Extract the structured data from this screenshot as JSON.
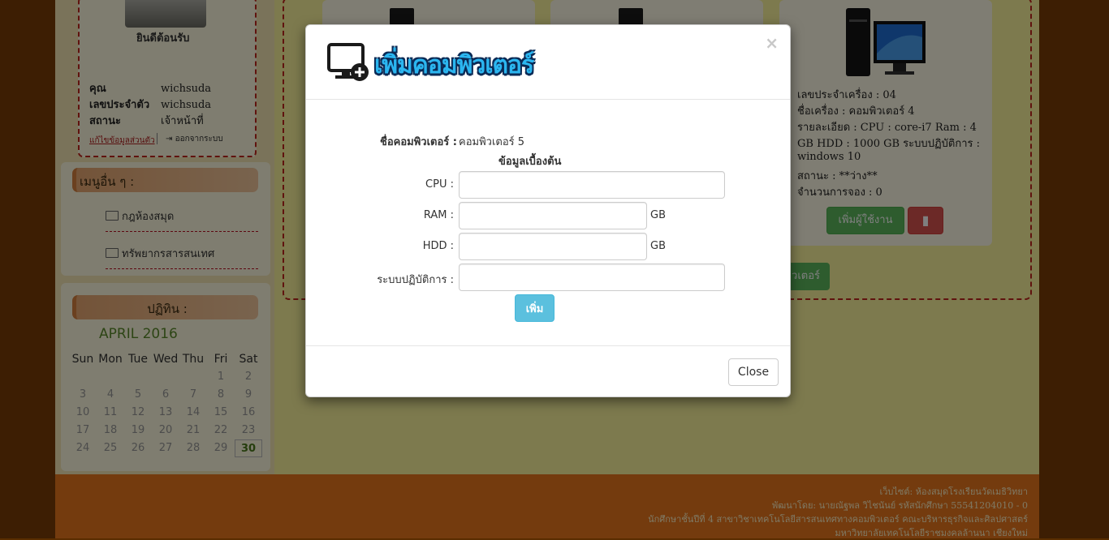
{
  "profile": {
    "welcome": "ยินดีต้อนรับ",
    "name_label": "คุณ",
    "name_value": "wichsuda",
    "id_label": "เลขประจำตัว",
    "id_value": "wichsuda",
    "status_label": "สถานะ",
    "status_value": "เจ้าหน้าที่",
    "edit_link": "แก้ไขข้อมูลส่วนตัว",
    "logout": "ออกจากระบบ"
  },
  "menu": {
    "title": "เมนูอื่น ๆ :",
    "items": [
      "กฎห้องสมุด",
      "ทรัพยากรสารสนเทศ"
    ]
  },
  "calendar": {
    "title": "ปฏิทิน :",
    "month": "APRIL 2016",
    "days": [
      "Sun",
      "Mon",
      "Tue",
      "Wed",
      "Thu",
      "Fri",
      "Sat"
    ],
    "weeks": [
      [
        "",
        "",
        "",
        "",
        "",
        "1",
        "2"
      ],
      [
        "3",
        "4",
        "5",
        "6",
        "7",
        "8",
        "9"
      ],
      [
        "10",
        "11",
        "12",
        "13",
        "14",
        "15",
        "16"
      ],
      [
        "17",
        "18",
        "19",
        "20",
        "21",
        "22",
        "23"
      ],
      [
        "24",
        "25",
        "26",
        "27",
        "28",
        "29",
        "30"
      ]
    ],
    "today": "30"
  },
  "card": {
    "lines": [
      "เลขประจำเครื่อง : 04",
      "ชื่อเครื่อง : คอมพิวเตอร์ 4",
      "รายละเอียด : CPU : core-i7 Ram : 4",
      "GB HDD : 1000 GB ระบบปฏิบัติการ :",
      "windows 10",
      "สถานะ : **ว่าง**",
      "จำนวนการจอง : 0"
    ],
    "add_user_button": "เพิ่มผู้ใช้งาน",
    "add_computer_button_partial": "วเตอร์"
  },
  "footer": {
    "lines": [
      "เว็บไซต์: ห้องสมุดโรงเรียนวัดเมธิวิทยา",
      "พัฒนาโดย: นายณัฐพล วิไชนันย์ รหัสนักศึกษา 55541204010 - 0",
      "นักศึกษาชั้นปีที่ 4 สาขาวิชาเทคโนโลยีสารสนเทศทางคอมพิวเตอร์ คณะบริหารธุรกิจและศิลปศาสตร์",
      "มหาวิทยาลัยเทคโนโลยีราชมงคลล้านนา เชียงใหม่"
    ]
  },
  "modal": {
    "title": "เพิ่มคอมพิวเตอร์",
    "close_x": "×",
    "computer_name_label": "ชื่อคอมพิวเตอร์ :",
    "computer_name_value": "คอมพิวเตอร์ 5",
    "section_title": "ข้อมูลเบื้องต้น",
    "cpu_label": "CPU :",
    "cpu_value": "",
    "ram_label": "RAM :",
    "ram_value": "",
    "ram_unit": "GB",
    "hdd_label": "HDD :",
    "hdd_value": "",
    "hdd_unit": "GB",
    "os_label": "ระบบปฏิบัติการ :",
    "os_value": "",
    "add_button": "เพิ่ม",
    "close_button": "Close"
  }
}
